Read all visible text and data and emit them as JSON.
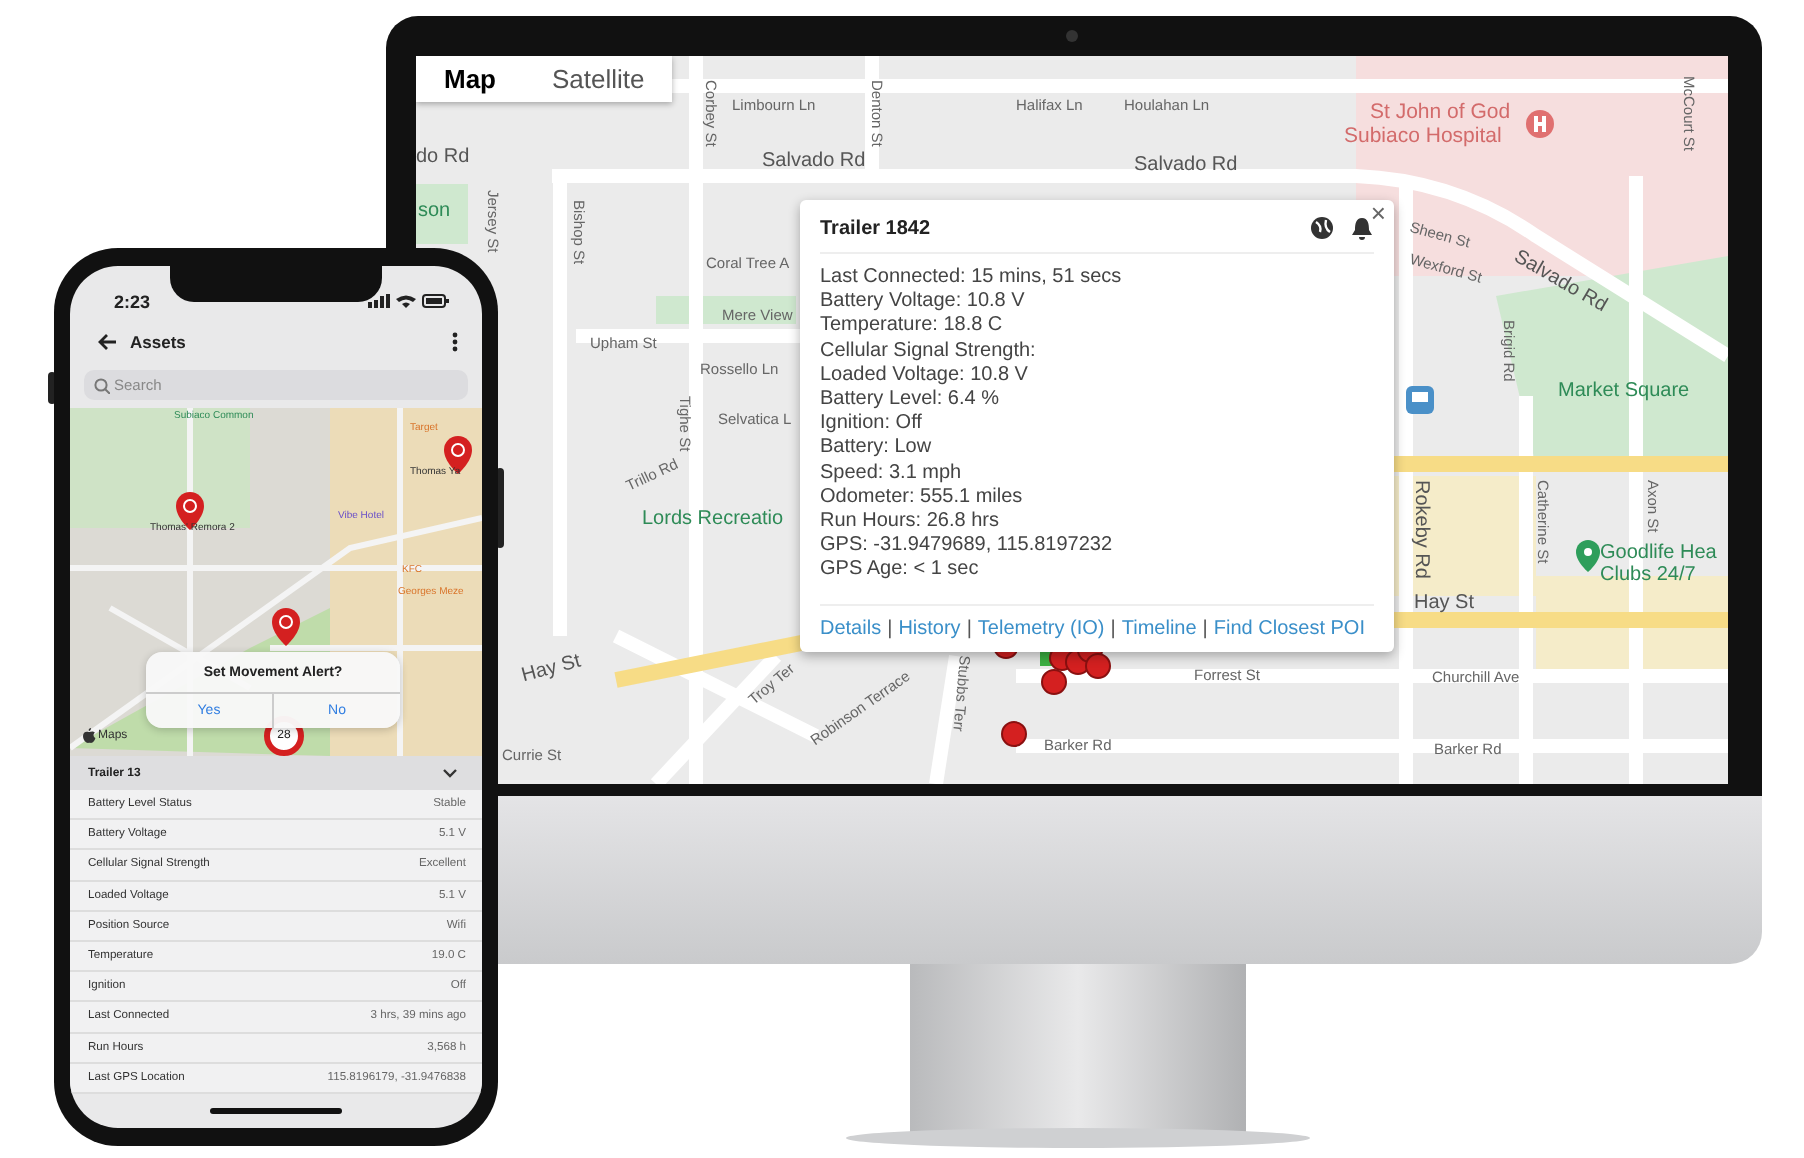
{
  "desktop": {
    "map_tabs": [
      {
        "label": "Map",
        "selected": true
      },
      {
        "label": "Satellite",
        "selected": false
      }
    ],
    "map_labels": [
      {
        "text": "Limbourn Ln",
        "kind": "street"
      },
      {
        "text": "Halifax Ln",
        "kind": "street"
      },
      {
        "text": "Houlahan Ln",
        "kind": "street"
      },
      {
        "text": "St John of God",
        "kind": "hospital"
      },
      {
        "text": "Subiaco Hospital",
        "kind": "hospital"
      },
      {
        "text": "Corbey St",
        "kind": "street"
      },
      {
        "text": "Denton St",
        "kind": "street"
      },
      {
        "text": "McCourt St",
        "kind": "street"
      },
      {
        "text": "do Rd",
        "kind": "road"
      },
      {
        "text": "Salvado Rd",
        "kind": "road"
      },
      {
        "text": "Salvado Rd",
        "kind": "road"
      },
      {
        "text": "son",
        "kind": "park"
      },
      {
        "text": "Jersey St",
        "kind": "street"
      },
      {
        "text": "Bishop St",
        "kind": "street"
      },
      {
        "text": "Upham St",
        "kind": "street"
      },
      {
        "text": "Coral Tree A",
        "kind": "street"
      },
      {
        "text": "Mere View",
        "kind": "street"
      },
      {
        "text": "Rossello Ln",
        "kind": "street"
      },
      {
        "text": "Selvatica L",
        "kind": "street"
      },
      {
        "text": "Tighe St",
        "kind": "street"
      },
      {
        "text": "Trillo Rd",
        "kind": "street"
      },
      {
        "text": "Lords Recreatio",
        "kind": "park"
      },
      {
        "text": "Sheen St",
        "kind": "street"
      },
      {
        "text": "Wexford St",
        "kind": "street"
      },
      {
        "text": "Salvado Rd",
        "kind": "road"
      },
      {
        "text": "Brigid Rd",
        "kind": "street"
      },
      {
        "text": "Market Square",
        "kind": "park"
      },
      {
        "text": "Rokeby Rd",
        "kind": "road"
      },
      {
        "text": "Catherine St",
        "kind": "street"
      },
      {
        "text": "Axon St",
        "kind": "street"
      },
      {
        "text": "Goodlife Hea",
        "kind": "park"
      },
      {
        "text": "Clubs 24/7",
        "kind": "park"
      },
      {
        "text": "Hay St",
        "kind": "road"
      },
      {
        "text": "Hay St",
        "kind": "road"
      },
      {
        "text": "Troy Ter",
        "kind": "street"
      },
      {
        "text": "Robinson Terrace",
        "kind": "street"
      },
      {
        "text": "Stubbs Terr",
        "kind": "street"
      },
      {
        "text": "Forrest St",
        "kind": "street"
      },
      {
        "text": "Churchill Ave",
        "kind": "street"
      },
      {
        "text": "Barker Rd",
        "kind": "street"
      },
      {
        "text": "Barker Rd",
        "kind": "street"
      },
      {
        "text": "Currie St",
        "kind": "street"
      }
    ],
    "popup": {
      "title": "Trailer 1842",
      "close": "×",
      "lines": [
        "Last Connected: 15 mins, 51 secs",
        "Battery Voltage: 10.8 V",
        "Temperature: 18.8 C",
        "Cellular Signal Strength:",
        "Loaded Voltage: 10.8 V",
        "Battery Level: 6.4 %",
        "Ignition: Off",
        "Battery: Low",
        "Speed: 3.1 mph",
        "Odometer: 555.1 miles",
        "Run Hours: 26.8 hrs",
        "GPS: -31.9479689, 115.8197232",
        "GPS Age: < 1 sec"
      ],
      "separator": "|",
      "links": [
        "Details",
        "History",
        "Telemetry (IO)",
        "Timeline",
        "Find Closest POI"
      ]
    }
  },
  "phone": {
    "time": "2:23",
    "title": "Assets",
    "search": {
      "placeholder": "Search"
    },
    "map_labels": [
      {
        "text": "Subiaco Common",
        "kind": "park"
      },
      {
        "text": "Target",
        "kind": "poi"
      },
      {
        "text": "Thomas Ya",
        "kind": "place"
      },
      {
        "text": "Thomas' Remora 2",
        "kind": "place"
      },
      {
        "text": "Vibe Hotel",
        "kind": "hotel"
      },
      {
        "text": "KFC",
        "kind": "poi"
      },
      {
        "text": "Georges Meze",
        "kind": "poi"
      }
    ],
    "cluster_count": "28",
    "maps_attribution": "Maps",
    "alert": {
      "title": "Set Movement Alert?",
      "buttons": [
        "Yes",
        "No"
      ]
    },
    "panel": {
      "title": "Trailer 13",
      "expanded": true,
      "rows": [
        {
          "label": "Battery Level Status",
          "value": "Stable"
        },
        {
          "label": "Battery Voltage",
          "value": "5.1 V"
        },
        {
          "label": "Cellular Signal Strength",
          "value": "Excellent"
        },
        {
          "label": "Loaded Voltage",
          "value": "5.1 V"
        },
        {
          "label": "Position Source",
          "value": "Wifi"
        },
        {
          "label": "Temperature",
          "value": "19.0 C"
        },
        {
          "label": "Ignition",
          "value": "Off"
        },
        {
          "label": "Last Connected",
          "value": "3 hrs, 39 mins ago"
        },
        {
          "label": "Run Hours",
          "value": "3,568 h"
        },
        {
          "label": "Last GPS Location",
          "value": "115.8196179, -31.9476838"
        }
      ]
    }
  }
}
